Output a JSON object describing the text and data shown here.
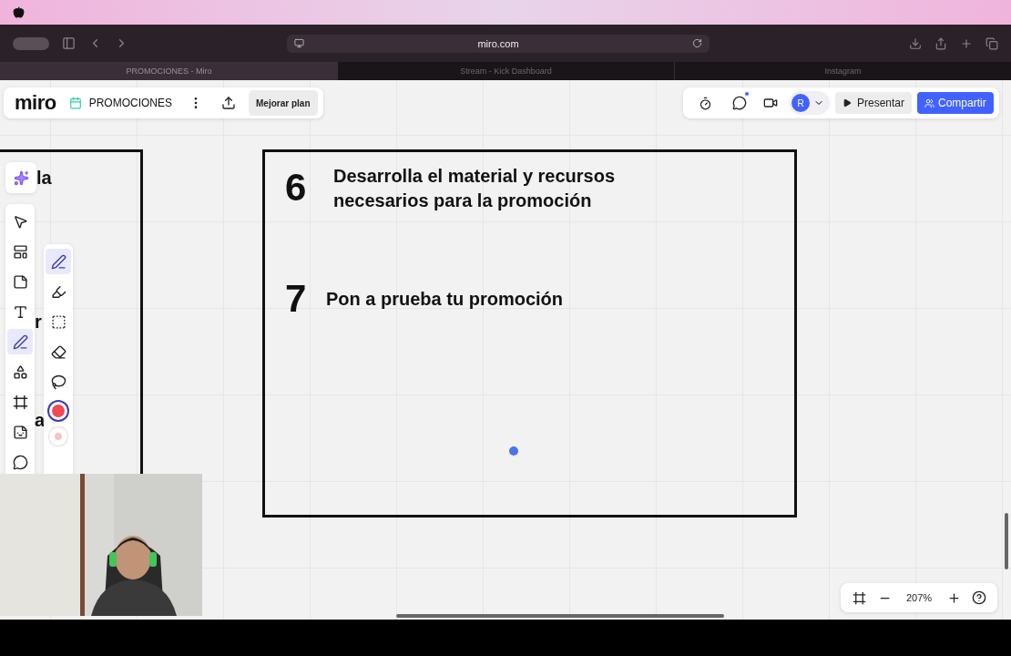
{
  "browser": {
    "address": "miro.com",
    "tabs": [
      {
        "label": "PROMOCIONES - Miro",
        "selected": true
      },
      {
        "label": "Stream - Kick Dashboard",
        "selected": false
      },
      {
        "label": "Instagram",
        "selected": false
      }
    ]
  },
  "board_bar": {
    "logo": "miro",
    "board_name": "PROMOCIONES",
    "upgrade_button": "Mejorar plan"
  },
  "share_bar": {
    "avatar": "R",
    "present_button": "Presentar",
    "share_button": "Compartir",
    "notification": true
  },
  "tools": [
    {
      "kind": "select",
      "selected": false
    },
    {
      "kind": "templates",
      "selected": false
    },
    {
      "kind": "sticky",
      "selected": false
    },
    {
      "kind": "text",
      "selected": false
    },
    {
      "kind": "pen",
      "selected": true
    },
    {
      "kind": "shapes",
      "selected": false
    },
    {
      "kind": "frame",
      "selected": false
    },
    {
      "kind": "sticker",
      "selected": false
    },
    {
      "kind": "comment",
      "selected": false
    }
  ],
  "pen_tools": [
    {
      "kind": "pen",
      "selected": true
    },
    {
      "kind": "highlighter",
      "selected": false
    },
    {
      "kind": "smart",
      "selected": false
    },
    {
      "kind": "eraser",
      "selected": false
    },
    {
      "kind": "lasso",
      "selected": false
    }
  ],
  "pen_colors": [
    {
      "color": "#ee4b55",
      "selected": true
    },
    {
      "color": "#f4c4c8",
      "selected": false
    }
  ],
  "left_frame_fragments": [
    "la",
    "r",
    "a"
  ],
  "frame": {
    "steps": [
      {
        "number": "6",
        "text": "Desarrolla el material y recursos necesarios para la promoción"
      },
      {
        "number": "7",
        "text": "Pon a prueba tu promoción"
      }
    ]
  },
  "zoom": {
    "value": "207%"
  }
}
